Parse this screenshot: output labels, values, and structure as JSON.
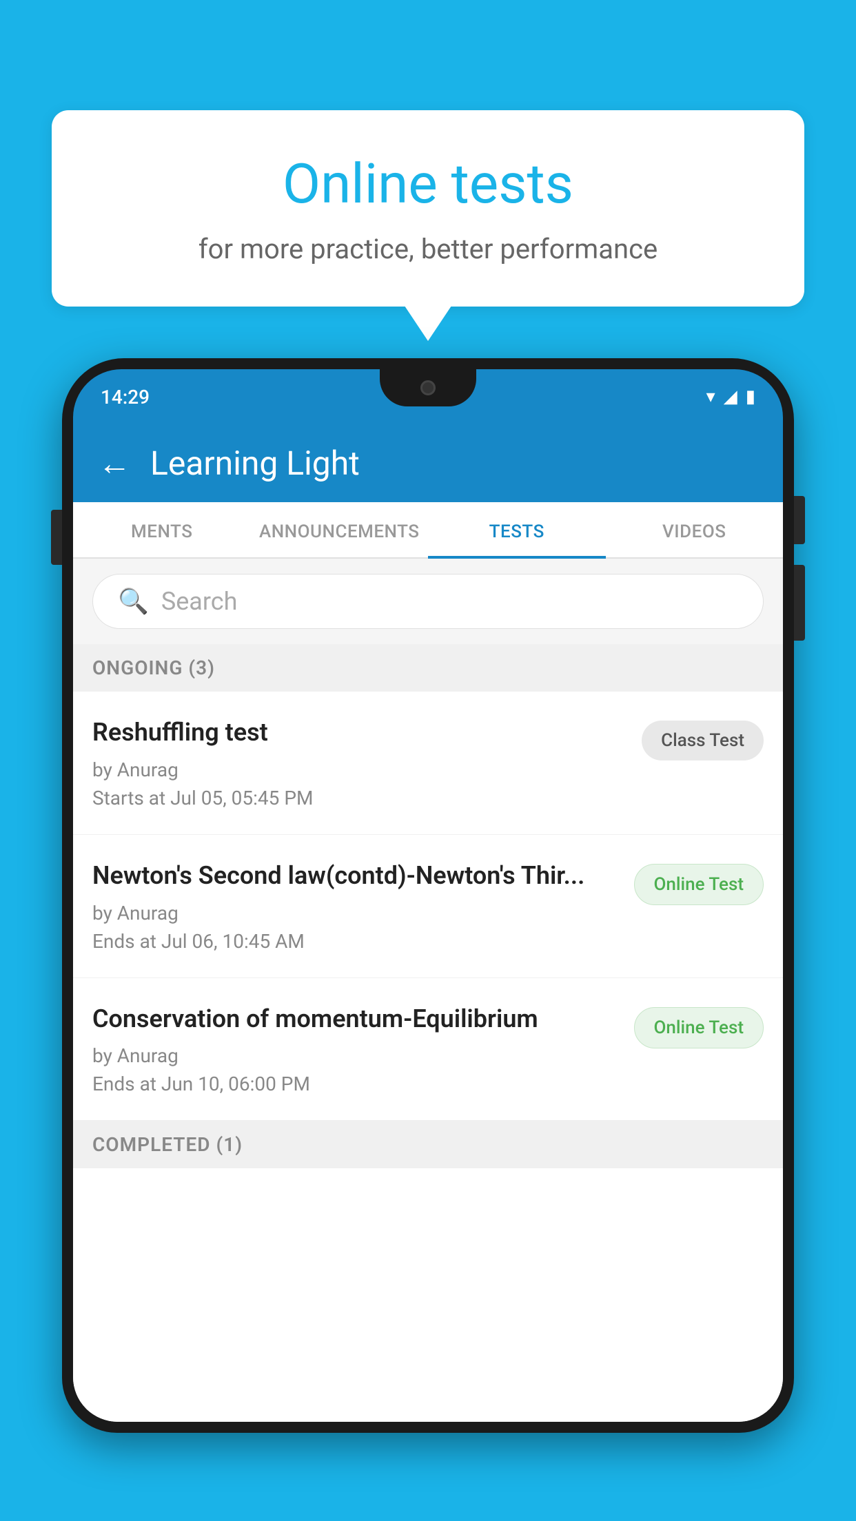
{
  "background_color": "#1ab3e8",
  "speech_bubble": {
    "title": "Online tests",
    "subtitle": "for more practice, better performance"
  },
  "phone": {
    "status_bar": {
      "time": "14:29",
      "icons": [
        "wifi",
        "signal",
        "battery"
      ]
    },
    "app_header": {
      "back_label": "←",
      "title": "Learning Light"
    },
    "tabs": [
      {
        "label": "MENTS",
        "active": false
      },
      {
        "label": "ANNOUNCEMENTS",
        "active": false
      },
      {
        "label": "TESTS",
        "active": true
      },
      {
        "label": "VIDEOS",
        "active": false
      }
    ],
    "search": {
      "placeholder": "Search"
    },
    "sections": [
      {
        "header": "ONGOING (3)",
        "items": [
          {
            "name": "Reshuffling test",
            "by": "by Anurag",
            "date": "Starts at  Jul 05, 05:45 PM",
            "badge": "Class Test",
            "badge_type": "class"
          },
          {
            "name": "Newton's Second law(contd)-Newton's Thir...",
            "by": "by Anurag",
            "date": "Ends at  Jul 06, 10:45 AM",
            "badge": "Online Test",
            "badge_type": "online"
          },
          {
            "name": "Conservation of momentum-Equilibrium",
            "by": "by Anurag",
            "date": "Ends at  Jun 10, 06:00 PM",
            "badge": "Online Test",
            "badge_type": "online"
          }
        ]
      }
    ],
    "completed_section_label": "COMPLETED (1)"
  }
}
